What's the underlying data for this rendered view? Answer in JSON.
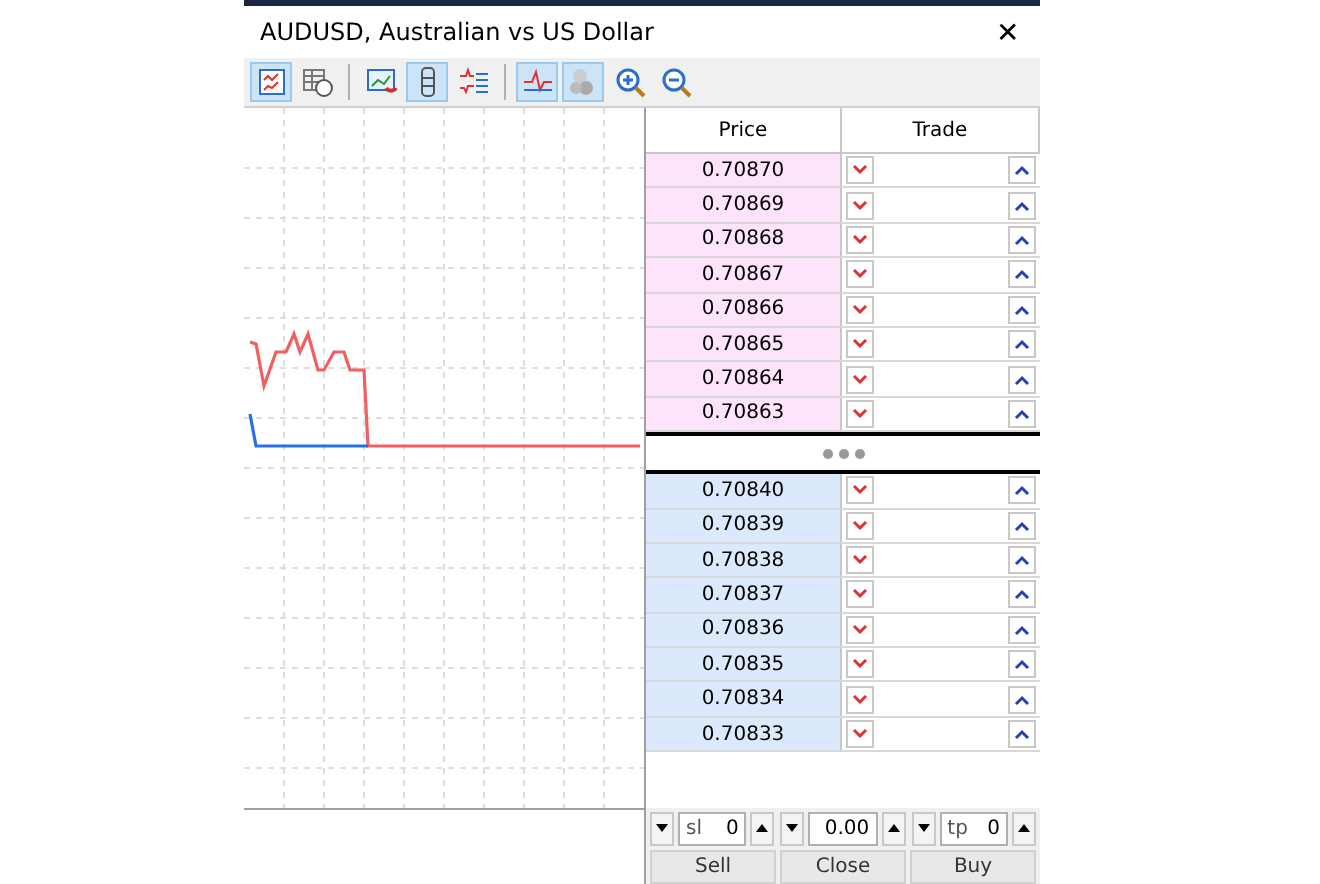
{
  "window": {
    "title": "AUDUSD, Australian vs US Dollar",
    "close": "✕"
  },
  "toolbar": [
    {
      "kind": "button",
      "selected": true
    },
    {
      "kind": "button",
      "selected": false
    },
    {
      "kind": "separator"
    },
    {
      "kind": "button",
      "selected": false
    },
    {
      "kind": "button",
      "selected": true
    },
    {
      "kind": "button",
      "selected": false
    },
    {
      "kind": "separator"
    },
    {
      "kind": "button",
      "selected": true
    },
    {
      "kind": "button",
      "selected": true
    },
    {
      "kind": "button",
      "selected": false
    },
    {
      "kind": "button",
      "selected": false
    }
  ],
  "ladder": {
    "columns": [
      "Price",
      "Trade"
    ],
    "rows": [
      {
        "kind": "ask",
        "price": "0.70870"
      },
      {
        "kind": "ask",
        "price": "0.70869"
      },
      {
        "kind": "ask",
        "price": "0.70868"
      },
      {
        "kind": "ask",
        "price": "0.70867"
      },
      {
        "kind": "ask",
        "price": "0.70866"
      },
      {
        "kind": "ask",
        "price": "0.70865"
      },
      {
        "kind": "ask",
        "price": "0.70864"
      },
      {
        "kind": "ask",
        "price": "0.70863"
      },
      {
        "kind": "gap"
      },
      {
        "kind": "bid",
        "price": "0.70840"
      },
      {
        "kind": "bid",
        "price": "0.70839"
      },
      {
        "kind": "bid",
        "price": "0.70838"
      },
      {
        "kind": "bid",
        "price": "0.70837"
      },
      {
        "kind": "bid",
        "price": "0.70836"
      },
      {
        "kind": "bid",
        "price": "0.70835"
      },
      {
        "kind": "bid",
        "price": "0.70834"
      },
      {
        "kind": "bid",
        "price": "0.70833"
      }
    ]
  },
  "order": {
    "spinners": [
      {
        "prefix": "sl",
        "value": "0"
      },
      {
        "value": "0.00"
      },
      {
        "prefix": "tp",
        "value": "0"
      }
    ],
    "buttons": [
      "Sell",
      "Close",
      "Buy"
    ]
  }
}
